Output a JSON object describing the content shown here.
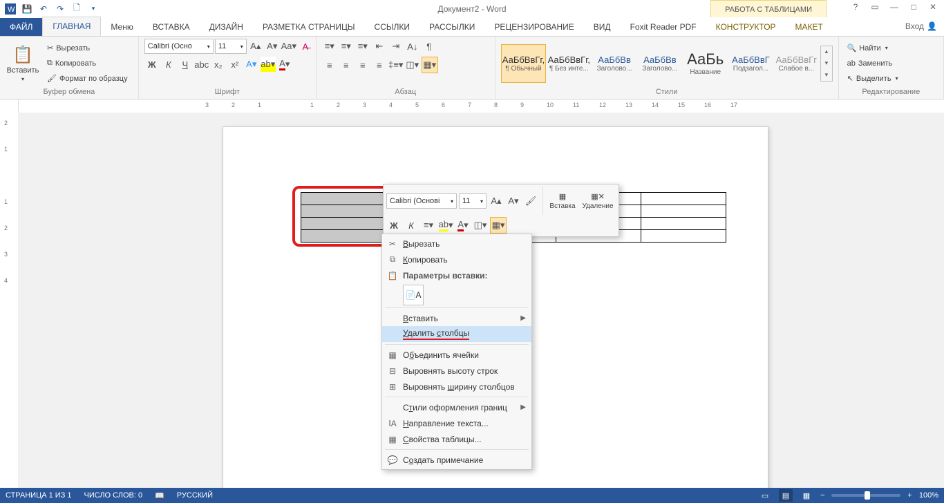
{
  "title": "Документ2 - Word",
  "table_tools_label": "РАБОТА С ТАБЛИЦАМИ",
  "login": "Вход",
  "tabs": {
    "file": "ФАЙЛ",
    "home": "ГЛАВНАЯ",
    "menu": "Меню",
    "insert": "ВСТАВКА",
    "design": "ДИЗАЙН",
    "layout": "РАЗМЕТКА СТРАНИЦЫ",
    "refs": "ССЫЛКИ",
    "mail": "РАССЫЛКИ",
    "review": "РЕЦЕНЗИРОВАНИЕ",
    "view": "ВИД",
    "foxit": "Foxit Reader PDF",
    "constructor": "КОНСТРУКТОР",
    "maket": "МАКЕТ"
  },
  "clipboard": {
    "paste": "Вставить",
    "cut": "Вырезать",
    "copy": "Копировать",
    "format_painter": "Формат по образцу",
    "group": "Буфер обмена"
  },
  "font": {
    "name": "Calibri (Осно",
    "size": "11",
    "group": "Шрифт",
    "bold": "Ж",
    "italic": "К",
    "underline": "Ч"
  },
  "paragraph": {
    "group": "Абзац"
  },
  "styles": {
    "group": "Стили",
    "items": [
      {
        "sample": "АаБбВвГг,",
        "name": "¶ Обычный",
        "sel": true
      },
      {
        "sample": "АаБбВвГг,",
        "name": "¶ Без инте..."
      },
      {
        "sample": "АаБбВв",
        "name": "Заголово...",
        "blue": true
      },
      {
        "sample": "АаБбВв",
        "name": "Заголово...",
        "blue": true
      },
      {
        "sample": "АаБь",
        "name": "Название",
        "big": true
      },
      {
        "sample": "АаБбВвГ",
        "name": "Подзагол...",
        "blue": true
      },
      {
        "sample": "АаБбВвГг",
        "name": "Слабое в...",
        "gray": true
      }
    ]
  },
  "editing": {
    "find": "Найти",
    "replace": "Заменить",
    "select": "Выделить",
    "group": "Редактирование"
  },
  "minitoolbar": {
    "font": "Calibri (Основі",
    "size": "11",
    "bold": "Ж",
    "italic": "К",
    "insert": "Вставка",
    "delete": "Удаление"
  },
  "context": {
    "cut": "Вырезать",
    "copy": "Копировать",
    "paste_options": "Параметры вставки:",
    "insert": "Вставить",
    "delete_cols": "Удалить столбцы",
    "merge": "Объединить ячейки",
    "dist_rows": "Выровнять высоту строк",
    "dist_cols": "Выровнять ширину столбцов",
    "border_styles": "Стили оформления границ",
    "text_dir": "Направление текста...",
    "table_props": "Свойства таблицы...",
    "new_comment": "Создать примечание"
  },
  "status": {
    "page": "СТРАНИЦА 1 ИЗ 1",
    "words": "ЧИСЛО СЛОВ: 0",
    "lang": "РУССКИЙ",
    "zoom": "100%"
  },
  "ruler_h": [
    "3",
    "2",
    "1",
    "",
    "1",
    "2",
    "3",
    "4",
    "5",
    "6",
    "7",
    "8",
    "9",
    "10",
    "11",
    "12",
    "13",
    "14",
    "15",
    "16",
    "17"
  ],
  "ruler_v": [
    "2",
    "1",
    "",
    "1",
    "2",
    "3",
    "4"
  ]
}
